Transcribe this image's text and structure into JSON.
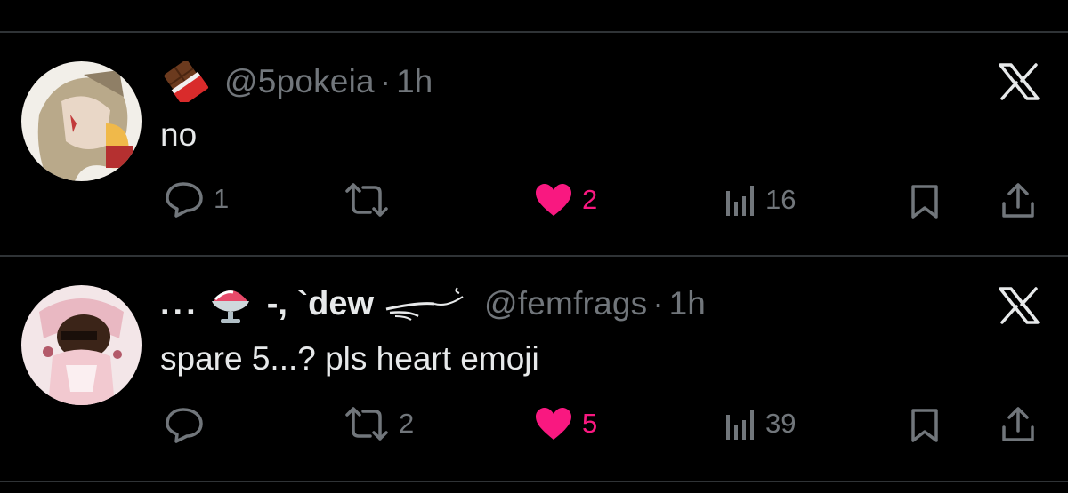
{
  "tweets": [
    {
      "handle": "@5pokeia",
      "separator": "·",
      "time": "1h",
      "text": "no",
      "name_emoji": "chocolate-bar",
      "stats": {
        "replies": "1",
        "retweets": "",
        "likes": "2",
        "views": "16"
      }
    },
    {
      "name_prefix": "...",
      "name_emoji": "shaved-ice",
      "name_mid": "-, ` ",
      "name": "dew",
      "name_suffix_icon": "wind-swirl",
      "handle": "@femfrags",
      "separator": "·",
      "time": "1h",
      "text": "spare 5...? pls heart emoji",
      "stats": {
        "replies": "",
        "retweets": "2",
        "likes": "5",
        "views": "39"
      }
    }
  ],
  "colors": {
    "background": "#000000",
    "text": "#e7e9ea",
    "muted": "#71767b",
    "like": "#f91880",
    "divider": "#2f3336"
  }
}
